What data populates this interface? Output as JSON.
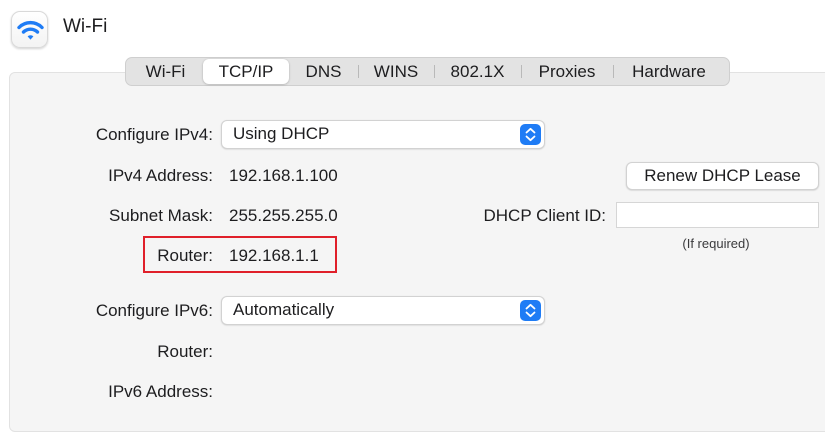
{
  "window": {
    "title": "Wi-Fi",
    "icon": "wifi-icon"
  },
  "tabs": [
    {
      "label": "Wi-Fi",
      "active": false
    },
    {
      "label": "TCP/IP",
      "active": true
    },
    {
      "label": "DNS",
      "active": false
    },
    {
      "label": "WINS",
      "active": false
    },
    {
      "label": "802.1X",
      "active": false
    },
    {
      "label": "Proxies",
      "active": false
    },
    {
      "label": "Hardware",
      "active": false
    }
  ],
  "ipv4": {
    "configure_label": "Configure IPv4:",
    "configure_value": "Using DHCP",
    "address_label": "IPv4 Address:",
    "address_value": "192.168.1.100",
    "subnet_label": "Subnet Mask:",
    "subnet_value": "255.255.255.0",
    "router_label": "Router:",
    "router_value": "192.168.1.1"
  },
  "dhcp": {
    "renew_button": "Renew DHCP Lease",
    "client_id_label": "DHCP Client ID:",
    "client_id_value": "",
    "client_id_hint": "(If required)"
  },
  "ipv6": {
    "configure_label": "Configure IPv6:",
    "configure_value": "Automatically",
    "router_label": "Router:",
    "address_label": "IPv6 Address:"
  },
  "colors": {
    "accent": "#1f7cf5",
    "highlight": "#e0202a",
    "panel": "#f5f5f5"
  }
}
